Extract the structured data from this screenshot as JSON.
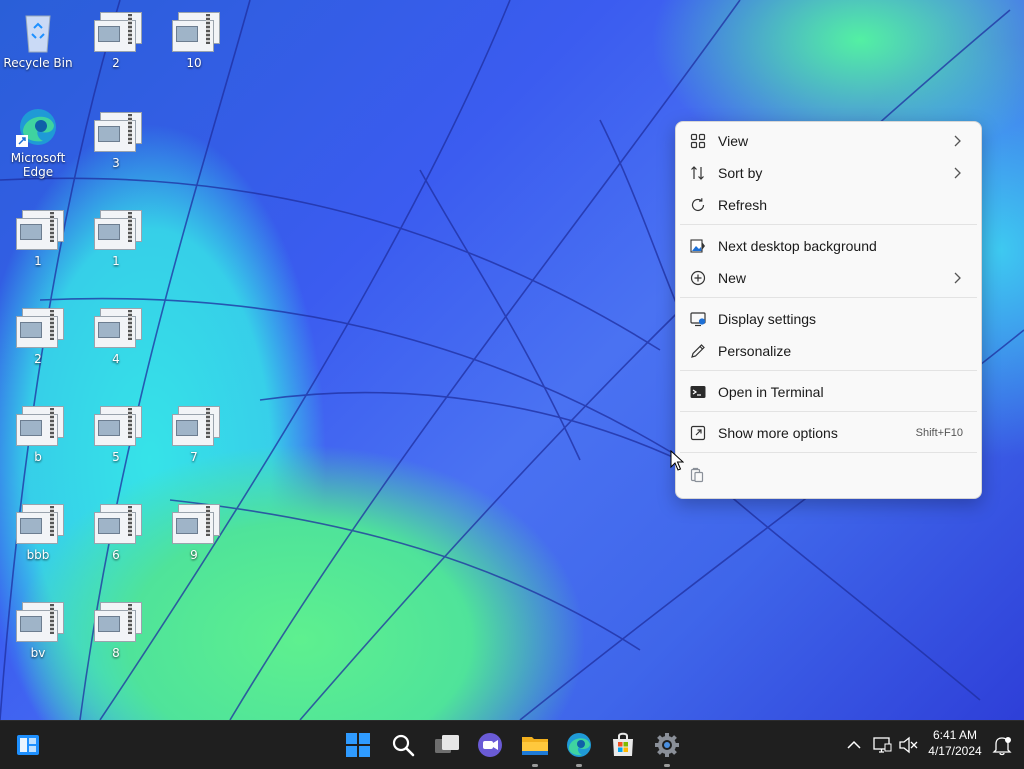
{
  "desktop": {
    "icons": [
      {
        "label": "Recycle Bin",
        "kind": "recycle-bin"
      },
      {
        "label": "2",
        "kind": "file"
      },
      {
        "label": "10",
        "kind": "file"
      },
      {
        "label": "Microsoft Edge",
        "kind": "edge"
      },
      {
        "label": "3",
        "kind": "file"
      },
      {
        "label": "1",
        "kind": "file"
      },
      {
        "label": "1",
        "kind": "file"
      },
      {
        "label": "2",
        "kind": "file"
      },
      {
        "label": "4",
        "kind": "file"
      },
      {
        "label": "b",
        "kind": "file"
      },
      {
        "label": "5",
        "kind": "file"
      },
      {
        "label": "7",
        "kind": "file"
      },
      {
        "label": "bbb",
        "kind": "file"
      },
      {
        "label": "6",
        "kind": "file"
      },
      {
        "label": "9",
        "kind": "file"
      },
      {
        "label": "bv",
        "kind": "file"
      },
      {
        "label": "8",
        "kind": "file"
      }
    ]
  },
  "context_menu": {
    "items": [
      {
        "label": "View",
        "icon": "grid-icon",
        "submenu": true
      },
      {
        "label": "Sort by",
        "icon": "sort-icon",
        "submenu": true
      },
      {
        "label": "Refresh",
        "icon": "refresh-icon",
        "submenu": false
      },
      {
        "label": "Next desktop background",
        "icon": "next-background-icon",
        "submenu": false
      },
      {
        "label": "New",
        "icon": "plus-circle-icon",
        "submenu": true
      },
      {
        "label": "Display settings",
        "icon": "display-settings-icon",
        "submenu": false
      },
      {
        "label": "Personalize",
        "icon": "pencil-icon",
        "submenu": false
      },
      {
        "label": "Open in Terminal",
        "icon": "terminal-icon",
        "submenu": false
      },
      {
        "label": "Show more options",
        "icon": "more-options-icon",
        "submenu": false,
        "accelerator": "Shift+F10"
      }
    ],
    "bottom_icon": "paste-icon"
  },
  "taskbar": {
    "clock_time": "6:41 AM",
    "clock_date": "4/17/2024",
    "accent": "#1e90ff"
  }
}
